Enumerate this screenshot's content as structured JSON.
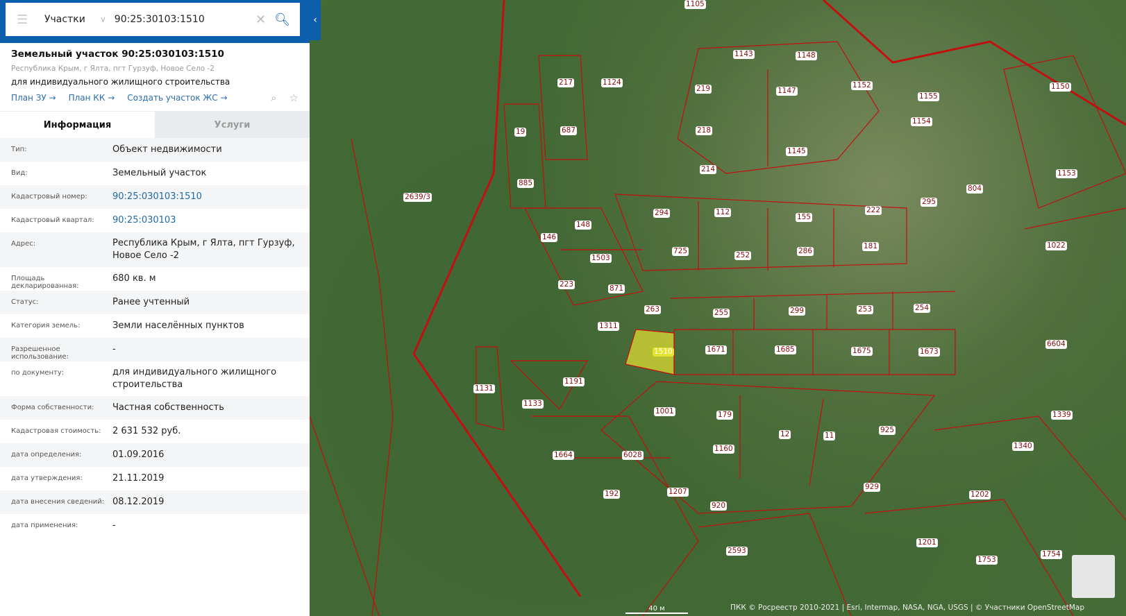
{
  "search": {
    "layer": "Участки",
    "query": "90:25:30103:1510"
  },
  "object": {
    "title": "Земельный участок 90:25:030103:1510",
    "address": "Республика Крым, г Ялта, пгт Гурзуф, Новое Село -2",
    "purpose": "для индивидуального жилищного строительства",
    "links": [
      "План ЗУ →",
      "План КК →",
      "Создать участок ЖС →"
    ]
  },
  "tabs": [
    "Информация",
    "Услуги"
  ],
  "rows": [
    {
      "k": "Тип:",
      "v": "Объект недвижимости"
    },
    {
      "k": "Вид:",
      "v": "Земельный участок"
    },
    {
      "k": "Кадастровый номер:",
      "v": "90:25:030103:1510"
    },
    {
      "k": "Кадастровый квартал:",
      "v": "90:25:030103"
    },
    {
      "k": "Адрес:",
      "v": "Республика Крым, г Ялта, пгт Гурзуф, Новое Село -2"
    },
    {
      "k": "Площадь декларированная:",
      "v": "680 кв. м"
    },
    {
      "k": "Статус:",
      "v": "Ранее учтенный"
    },
    {
      "k": "Категория земель:",
      "v": "Земли населённых пунктов"
    },
    {
      "k": "Разрешенное использование:",
      "v": "-"
    },
    {
      "k": "по документу:",
      "v": "для индивидуального жилищного строительства"
    },
    {
      "k": "Форма собственности:",
      "v": "Частная собственность"
    },
    {
      "k": "Кадастровая стоимость:",
      "v": "2 631 532 руб."
    },
    {
      "k": "дата определения:",
      "v": "01.09.2016"
    },
    {
      "k": "дата утверждения:",
      "v": "21.11.2019"
    },
    {
      "k": "дата внесения сведений:",
      "v": "08.12.2019"
    },
    {
      "k": "дата применения:",
      "v": "-"
    }
  ],
  "parcels": [
    "1510",
    "1671",
    "1685",
    "1675",
    "1673",
    "255",
    "299",
    "253",
    "254",
    "263",
    "1311",
    "871",
    "223",
    "1503",
    "146",
    "148",
    "885",
    "19",
    "687",
    "217",
    "1124",
    "219",
    "218",
    "214",
    "112",
    "294",
    "725",
    "252",
    "286",
    "181",
    "155",
    "222",
    "295",
    "804",
    "1143",
    "1148",
    "1147",
    "1152",
    "1155",
    "1154",
    "1145",
    "1150",
    "1153",
    "1022",
    "2639/3",
    "1131",
    "1133",
    "1191",
    "1001",
    "179",
    "12",
    "11",
    "925",
    "1160",
    "929",
    "1664",
    "6028",
    "192",
    "1207",
    "920",
    "2593",
    "1201",
    "1753",
    "1754",
    "1339",
    "1340",
    "1202",
    "6604",
    "1105"
  ],
  "attribution": "ПКК © Росреестр 2010-2021 | Esri, Intermap, NASA, NGA, USGS | © Участники OpenStreetMap",
  "scale": "40 м"
}
